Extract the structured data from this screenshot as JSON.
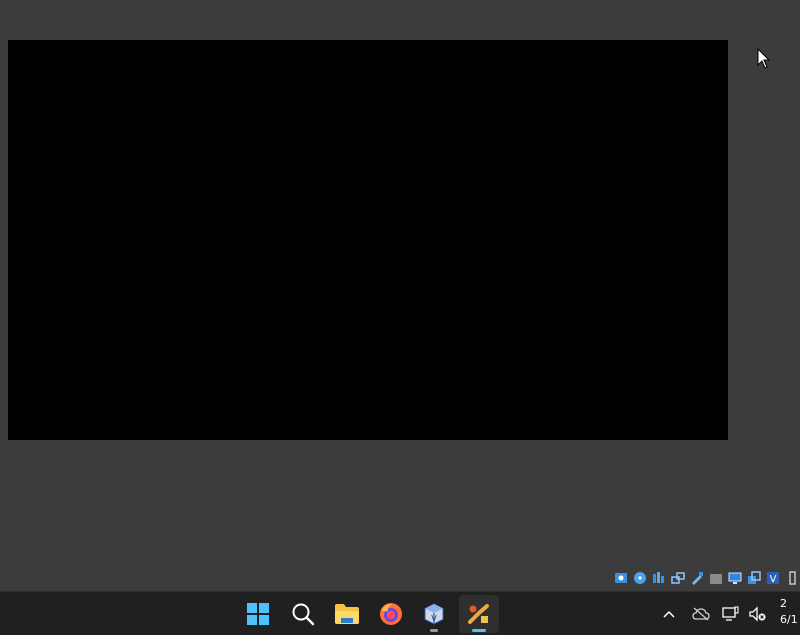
{
  "vm": {
    "screen_content": ""
  },
  "status_bar": {
    "icons": [
      "hard-disk-icon",
      "optical-disk-icon",
      "audio-icon",
      "network-icon",
      "usb-icon",
      "shared-folder-icon",
      "display-icon",
      "recording-icon",
      "capture-icon",
      "host-key-icon"
    ]
  },
  "taskbar": {
    "apps": [
      {
        "name": "start-button",
        "icon": "windows-logo-icon"
      },
      {
        "name": "search-button",
        "icon": "search-icon"
      },
      {
        "name": "file-explorer-button",
        "icon": "folder-icon"
      },
      {
        "name": "firefox-button",
        "icon": "firefox-icon"
      },
      {
        "name": "virtualbox-button",
        "icon": "virtualbox-icon"
      },
      {
        "name": "vm-window-button",
        "icon": "vm-app-icon",
        "active": true
      }
    ],
    "tray": {
      "icons": [
        "chevron-up-icon",
        "onedrive-offline-icon",
        "network-icon",
        "volume-muted-icon"
      ],
      "time": "2",
      "date": "6/1"
    }
  },
  "colors": {
    "desktop": "#3c3c3c",
    "taskbar": "#202020",
    "accent": "#4cc2ff"
  }
}
